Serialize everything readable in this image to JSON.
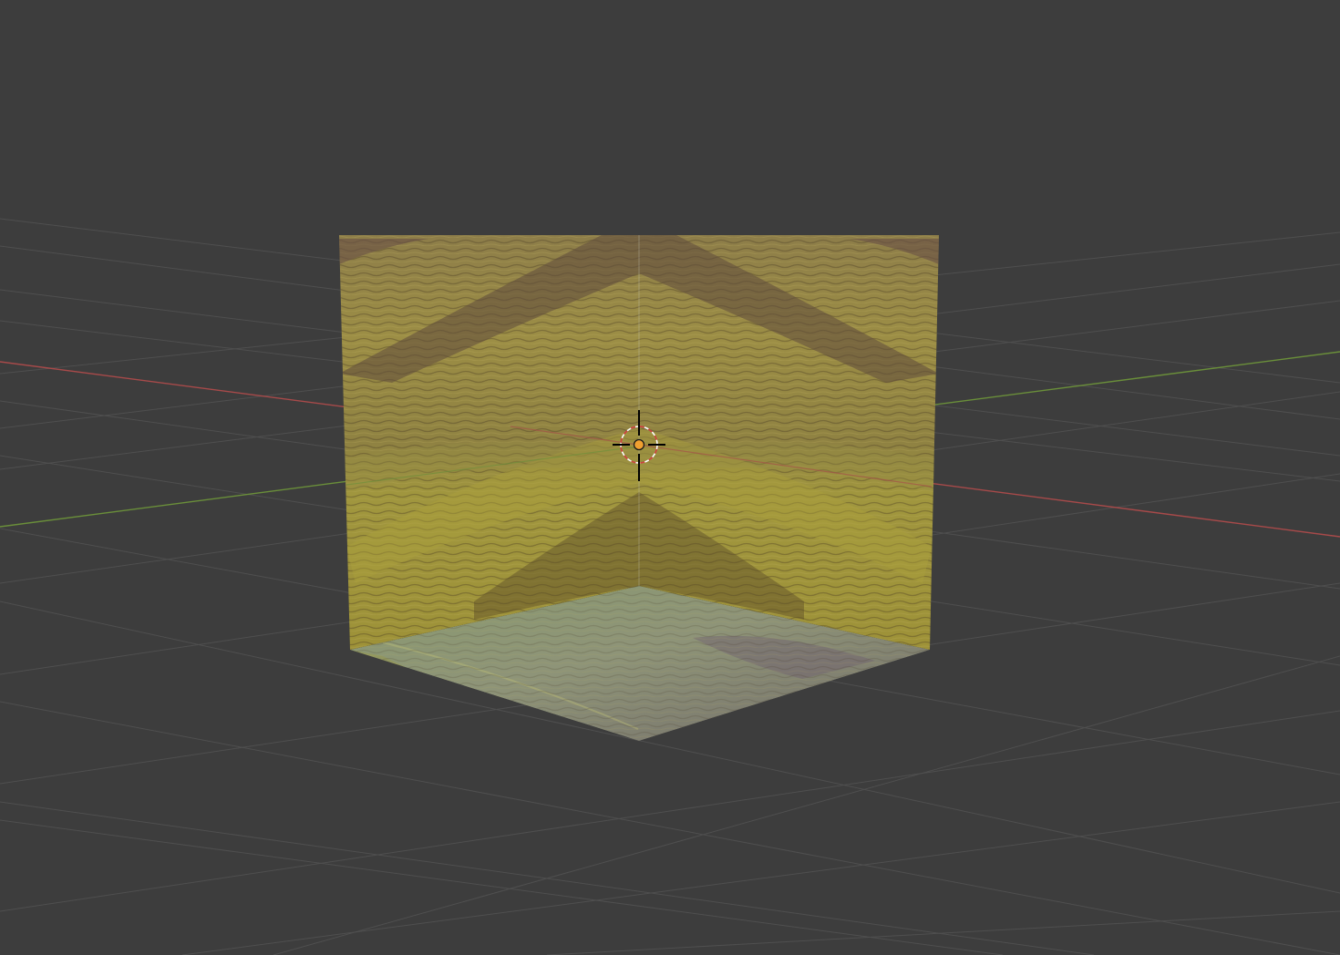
{
  "viewport": {
    "background": "#3d3d3d",
    "grid_color": "#4f4f4f",
    "x_axis_color": "#a84a4a",
    "y_axis_color": "#6a8f3a"
  },
  "object": {
    "type": "textured-corner-planes",
    "texture": "grass-hillside",
    "texture_colors": {
      "light": "#a3953f",
      "mid": "#8a7f3a",
      "dark": "#6a5a3a",
      "shadow": "#5a4a3c",
      "floor_light": "#8e9478",
      "floor_dark": "#6f6a6a"
    }
  },
  "origin_marker": {
    "color": "#f0a030"
  },
  "cursor_3d": {
    "ring_color_a": "#ffffff",
    "ring_color_b": "#d04040",
    "cross_color": "#000000"
  }
}
